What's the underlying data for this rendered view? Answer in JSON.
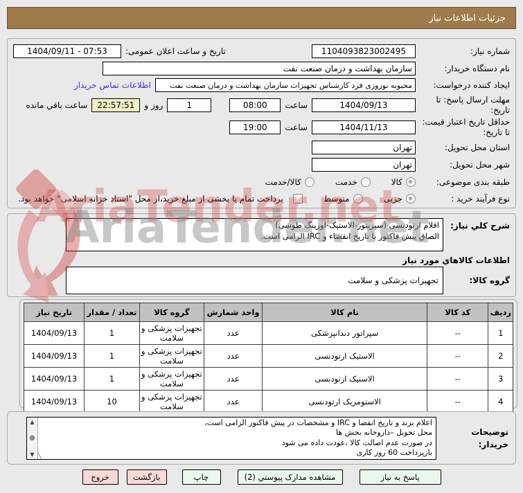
{
  "title_bar": {
    "text": "جزئیات اطلاعات نیاز"
  },
  "watermark": {
    "text": "AriaTender.net"
  },
  "form": {
    "need_number": {
      "label": "شماره نیاز:",
      "value": "1104093823002495"
    },
    "public_announce": {
      "label": "تاریخ و ساعت اعلان عمومی:",
      "value": "1404/09/11 - 07:53"
    },
    "buyer_org": {
      "label": "نام دستگاه خریدار:",
      "value": "سازمان بهداشت و درمان صنعت نفت"
    },
    "request_creator": {
      "label": "ایجاد کننده درخواست:",
      "value": "محبوبه نوروزی فرد کارشناس تجهیزات سازمان بهداشت و درمان صنعت نفت",
      "contact_link": "اطلاعات تماس خریدار"
    },
    "response_deadline": {
      "label": "مهلت ارسال پاسخ: تا تاریخ:",
      "date": "1404/09/13",
      "time_label": "ساعت",
      "time": "08:00"
    },
    "remaining": {
      "days": "1",
      "days_label": "روز و",
      "time": "22:57:51",
      "suffix_label": "ساعت باقي مانده"
    },
    "price_validity": {
      "label": "حداقل تاریخ اعتبار قیمت: تا تاریخ:",
      "date": "1404/11/13",
      "time_label": "ساعت",
      "time": "19:00"
    },
    "province": {
      "label": "استان محل تحویل:",
      "value": "تهران"
    },
    "city": {
      "label": "شهر محل تحویل:",
      "value": "تهران"
    },
    "subject_class": {
      "label": "طبقه بندی موضوعی:",
      "options": [
        "کالا",
        "خدمت",
        "کالا/خدمت"
      ],
      "selected": "کالا"
    },
    "process_type": {
      "label": "نوع فرآیند خرید :",
      "options": [
        "جزیی",
        "متوسط"
      ],
      "selected": "جزیی",
      "checkbox_label": "پرداخت تمام یا بخشی از مبلغ خرید،از محل \"اسناد خزانه اسلامی\" خواهد بود.",
      "checkbox_checked": false
    }
  },
  "description": {
    "label": "شرح کلي نیاز:",
    "lines": [
      "اقلام ارتودنسی (سپریتور-الاستیک-اورینگ طوسی)",
      "الصاق پیش فاکتور با تاریخ انقضاء و IRC الزامی است."
    ]
  },
  "goods_section": {
    "header": "اطلاعات کالاهاي مورد نیاز",
    "group_label": "گروه کالا:",
    "group_value": "تجهیزات پزشکی و سلامت"
  },
  "table": {
    "headers": [
      "ردیف",
      "کد کالا",
      "نام کالا",
      "واحد شمارش",
      "گروه کالا",
      "تعداد / مقدار",
      "تاریخ نیاز"
    ],
    "rows": [
      [
        "1",
        "--",
        "سپراتور دندانپزشکی",
        "عدد",
        "تجهیزات پزشکی و سلامت",
        "1",
        "1404/09/13"
      ],
      [
        "2",
        "--",
        "الاستیک ارتودنسی",
        "عدد",
        "تجهیزات پزشکی و سلامت",
        "1",
        "1404/09/13"
      ],
      [
        "3",
        "--",
        "الاستیک ارتودنسی",
        "عدد",
        "تجهیزات پزشکی و سلامت",
        "1",
        "1404/09/13"
      ],
      [
        "4",
        "--",
        "الاستومریک ارتودنسی",
        "عدد",
        "تجهیزات پزشکی و سلامت",
        "10",
        "1404/09/13"
      ]
    ]
  },
  "buyer_notes": {
    "label": "توضیحات خریدار:",
    "lines": [
      "اعلام برند و تاریخ انقضا و IRC و مشخصات در پیش فاکتور الزامی است،",
      "محل تحویل –داروخانه بخش ها",
      "در صورت عدم اصالت کالا ،عودت داده می شود",
      "بازپرداخت 60 روز کاری"
    ],
    "scrollbar": {
      "up_icon": "▲",
      "thumb_icon": "●",
      "down_icon": "▼"
    }
  },
  "buttons": [
    {
      "label": "پاسخ به نیاز",
      "style": "green"
    },
    {
      "label": "مشاهده مدارک پیوستي (2)",
      "style": "green"
    },
    {
      "label": "چاپ",
      "style": "green"
    },
    {
      "label": "بازگشت",
      "style": "pink"
    },
    {
      "label": "خروج",
      "style": "pink"
    }
  ],
  "colors": {
    "title_bar": "#9f7b4c",
    "countdown_bg": "#f2eec5",
    "link": "#3a39d4",
    "table_header_bg": "#c2c2c2",
    "green_button_bg": "#eaf7ec",
    "pink_button_bg": "#f9d8d6",
    "watermark_red": "#cc3333",
    "watermark_gray": "#828282"
  }
}
